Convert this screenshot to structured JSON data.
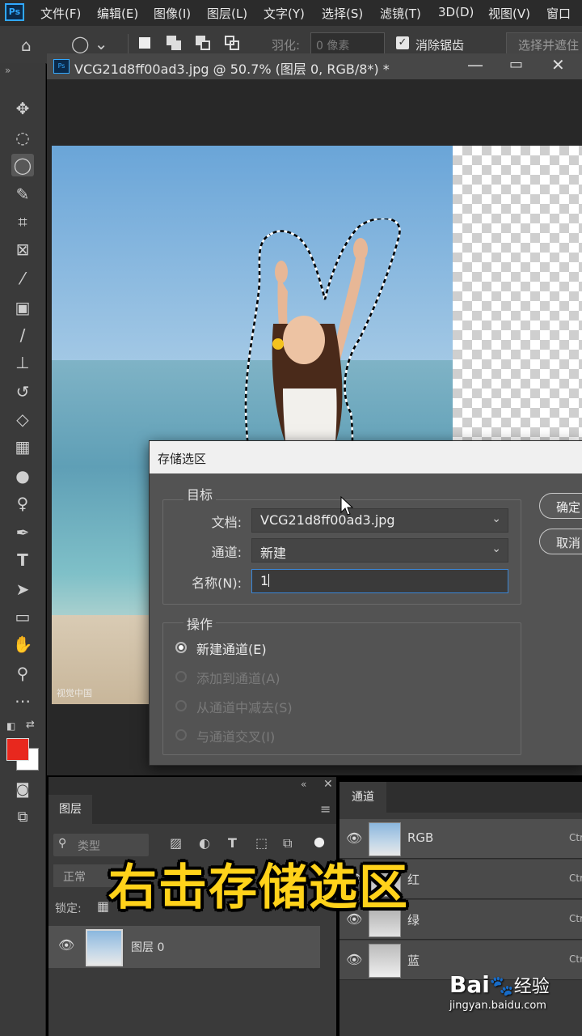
{
  "app": {
    "logo": "Ps"
  },
  "menu": [
    "文件(F)",
    "编辑(E)",
    "图像(I)",
    "图层(L)",
    "文字(Y)",
    "选择(S)",
    "滤镜(T)",
    "3D(D)",
    "视图(V)",
    "窗口"
  ],
  "options_bar": {
    "feather_label": "羽化:",
    "feather_value": "0 像素",
    "antialias_label": "消除锯齿",
    "antialias_checked": true,
    "select_mask_label": "选择并遮住"
  },
  "document": {
    "tab_title": "VCG21d8ff00ad3.jpg @ 50.7% (图层 0, RGB/8*) *",
    "corner_watermark": "视觉中国"
  },
  "dialog": {
    "title": "存储选区",
    "target_group": "目标",
    "document_label": "文档:",
    "document_value": "VCG21d8ff00ad3.jpg",
    "channel_label": "通道:",
    "channel_value": "新建",
    "name_label": "名称(N):",
    "name_value": "1",
    "operation_group": "操作",
    "ok_label": "确定",
    "cancel_label": "取消",
    "options": [
      {
        "label": "新建通道(E)",
        "selected": true,
        "enabled": true
      },
      {
        "label": "添加到通道(A)",
        "selected": false,
        "enabled": false
      },
      {
        "label": "从通道中减去(S)",
        "selected": false,
        "enabled": false
      },
      {
        "label": "与通道交叉(I)",
        "selected": false,
        "enabled": false
      }
    ]
  },
  "layers_panel": {
    "tab": "图层",
    "search_placeholder": "类型",
    "blend_mode": "正常",
    "lock_label": "锁定:",
    "layer_name": "图层 0"
  },
  "channels_panel": {
    "tab": "通道",
    "channels": [
      {
        "name": "RGB",
        "shortcut": "Ctr"
      },
      {
        "name": "红",
        "shortcut": "Ctr"
      },
      {
        "name": "绿",
        "shortcut": "Ctr"
      },
      {
        "name": "蓝",
        "shortcut": "Ctr"
      }
    ]
  },
  "colors": {
    "foreground": "#e8281e",
    "background": "#ffffff",
    "accent": "#31a8ff",
    "caption": "#ffd21a"
  },
  "overlay_caption": "右击存储选区",
  "watermark": {
    "brand": "Bai",
    "brand2": "经验",
    "url": "jingyan.baidu.com"
  }
}
